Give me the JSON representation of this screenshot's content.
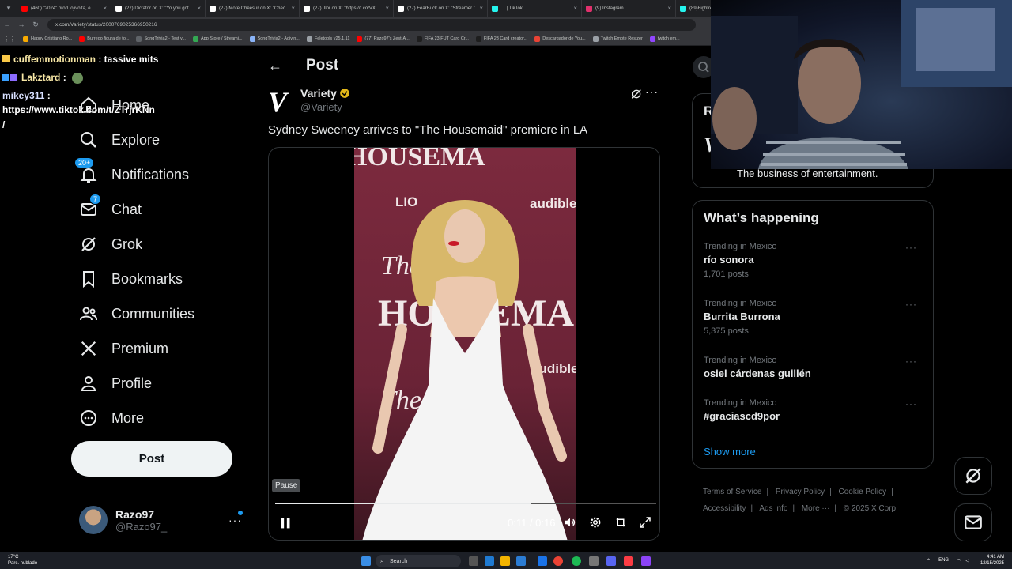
{
  "browser": {
    "tabs": [
      {
        "label": "(460) \"2024\" prod. ojivolta, e...",
        "color": "#ff0000"
      },
      {
        "label": "(27) Dictator on X: \"Yo you got...",
        "color": "#ffffff"
      },
      {
        "label": "(27) More Cheesur on X: \"Chec...",
        "color": "#ffffff"
      },
      {
        "label": "(27) Jlor on X: \"https://t.co/VX...",
        "color": "#ffffff"
      },
      {
        "label": "(27) FearBuck on X: \"Streamer f...",
        "color": "#ffffff"
      },
      {
        "label": "... | TikTok",
        "color": "#25f4ee"
      },
      {
        "label": "(9) Instagram",
        "color": "#e1306c"
      },
      {
        "label": "(89)Fightrer...",
        "color": "#25f4ee"
      }
    ],
    "url": "x.com/Variety/status/2000769025366950216",
    "bookmarks": [
      {
        "label": "Happy Cristiano Ro...",
        "color": "#f9ab00"
      },
      {
        "label": "Burrego figura de to...",
        "color": "#ff0000"
      },
      {
        "label": "SongTrivia2 - Test y...",
        "color": "#5f6368"
      },
      {
        "label": "App Store / Streami...",
        "color": "#34a853"
      },
      {
        "label": "SongTrivia2 - Adivin...",
        "color": "#8ab4f8"
      },
      {
        "label": "Feletools v25.1.11",
        "color": "#9aa0a6"
      },
      {
        "label": "(77) Razo97's Zest-A...",
        "color": "#ff0000"
      },
      {
        "label": "FIFA 23 FUT Card Cr...",
        "color": "#1e1e1e"
      },
      {
        "label": "FIFA 23 Card creator...",
        "color": "#1e1e1e"
      },
      {
        "label": "Descargador de You...",
        "color": "#ea4335"
      },
      {
        "label": "Twitch Emote Resizer",
        "color": "#9aa0a6"
      },
      {
        "label": "twitch em...",
        "color": "#9146ff"
      }
    ]
  },
  "chat": [
    {
      "user": "cuffemmotionman",
      "message": " : tassive mits"
    },
    {
      "user": "Lakztard",
      "message": " :"
    },
    {
      "user": "mikey311",
      "message": " :"
    },
    {
      "user": "",
      "message": "https://www.tiktok.com/t/ZTrjrKNn"
    },
    {
      "user": "",
      "message": "/"
    }
  ],
  "nav": {
    "items": [
      {
        "label": "Home"
      },
      {
        "label": "Explore"
      },
      {
        "label": "Notifications",
        "badge": "20+"
      },
      {
        "label": "Chat",
        "badge": "7"
      },
      {
        "label": "Grok"
      },
      {
        "label": "Bookmarks"
      },
      {
        "label": "Communities"
      },
      {
        "label": "Premium"
      },
      {
        "label": "Profile"
      },
      {
        "label": "More"
      }
    ],
    "post_label": "Post",
    "account": {
      "display_name": "Razo97",
      "handle": "@Razo97_"
    }
  },
  "main": {
    "title": "Post",
    "author": {
      "name": "Variety",
      "handle": "@Variety",
      "logo": "V"
    },
    "text": "Sydney Sweeney arrives to \"The Housemaid\" premiere in LA",
    "video": {
      "tooltip": "Pause",
      "time": "0:11 / 0:16",
      "progress": 0.67,
      "backdrop_text": [
        "HOUSEMA",
        "LIO",
        "audible",
        "The",
        "HOUSEMA",
        "audible",
        "The"
      ]
    }
  },
  "right": {
    "profile_tagline": "The business of entertainment.",
    "profile_title_initial": "R",
    "happening_title": "What’s happening",
    "trends": [
      {
        "context": "Trending in Mexico",
        "topic": "río sonora",
        "count": "1,701 posts"
      },
      {
        "context": "Trending in Mexico",
        "topic": "Burrita Burrona",
        "count": "5,375 posts"
      },
      {
        "context": "Trending in Mexico",
        "topic": "osiel cárdenas guillén",
        "count": ""
      },
      {
        "context": "Trending in Mexico",
        "topic": "#graciascd9por",
        "count": ""
      }
    ],
    "show_more": "Show more",
    "footer": [
      "Terms of Service",
      "Privacy Policy",
      "Cookie Policy",
      "Accessibility",
      "Ads info",
      "More ···",
      "© 2025 X Corp."
    ]
  },
  "taskbar": {
    "weather_temp": "17°C",
    "weather_desc": "Parc. nublado",
    "search_label": "Search",
    "language": "ENG",
    "time": "4:41 AM",
    "date": "12/15/2025"
  },
  "colors": {
    "accent": "#1d9bf0",
    "background": "#000000",
    "border": "#2f3336",
    "muted_text": "#71767b"
  }
}
